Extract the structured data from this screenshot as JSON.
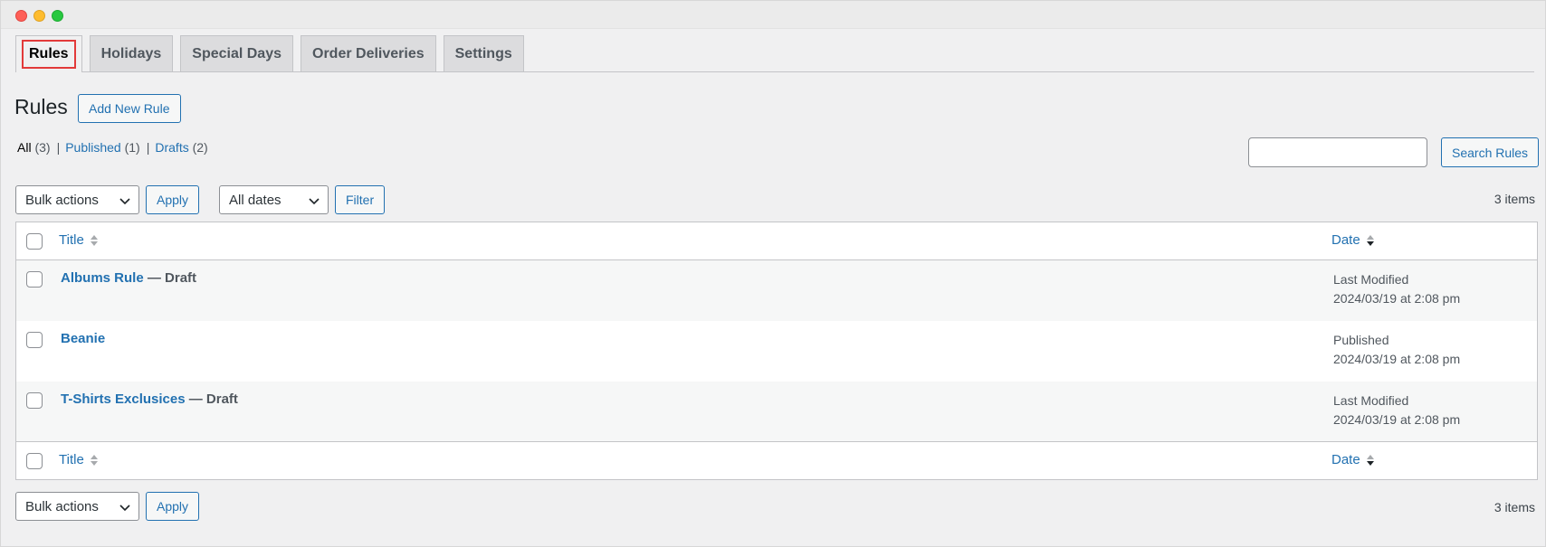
{
  "tabs": [
    {
      "label": "Rules",
      "active": true
    },
    {
      "label": "Holidays",
      "active": false
    },
    {
      "label": "Special Days",
      "active": false
    },
    {
      "label": "Order Deliveries",
      "active": false
    },
    {
      "label": "Settings",
      "active": false
    }
  ],
  "page": {
    "title": "Rules",
    "add_new_label": "Add New Rule"
  },
  "views": {
    "all_label": "All",
    "all_count": "(3)",
    "published_label": "Published",
    "published_count": "(1)",
    "drafts_label": "Drafts",
    "drafts_count": "(2)",
    "separator": "|"
  },
  "search": {
    "value": "",
    "button_label": "Search Rules"
  },
  "toolbar_top": {
    "bulk_actions": "Bulk actions",
    "apply_label": "Apply",
    "dates": "All dates",
    "filter_label": "Filter",
    "items_count": "3 items"
  },
  "table": {
    "header": {
      "title": "Title",
      "date": "Date"
    },
    "footer": {
      "title": "Title",
      "date": "Date"
    },
    "rows": [
      {
        "title": "Albums Rule",
        "state": " — Draft",
        "date_status": "Last Modified",
        "date": "2024/03/19 at 2:08 pm"
      },
      {
        "title": "Beanie",
        "state": "",
        "date_status": "Published",
        "date": "2024/03/19 at 2:08 pm"
      },
      {
        "title": "T-Shirts Exclusices",
        "state": " — Draft",
        "date_status": "Last Modified",
        "date": "2024/03/19 at 2:08 pm"
      }
    ]
  },
  "toolbar_bottom": {
    "bulk_actions": "Bulk actions",
    "apply_label": "Apply",
    "items_count": "3 items"
  },
  "colors": {
    "accent": "#2271b1",
    "active_tab_highlight": "#e23a3a",
    "window_red": "#fe5f57",
    "window_yellow": "#febc2e",
    "window_green": "#28c840"
  },
  "icons": {
    "sort_title": "sort-both-icon",
    "sort_date": "sort-desc-icon",
    "select_chevron": "chevron-down-icon"
  }
}
